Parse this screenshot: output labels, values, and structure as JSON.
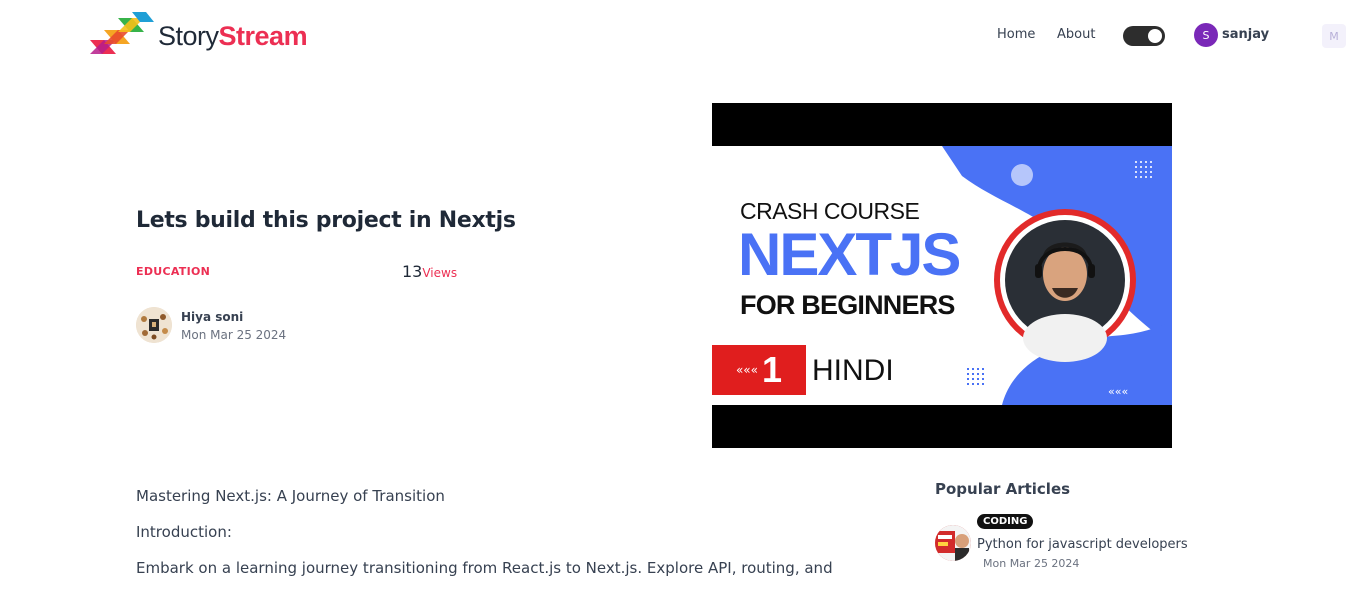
{
  "brand": {
    "part1": "Story",
    "part2": "Stream",
    "accent": "#ec2f53"
  },
  "nav": {
    "home": "Home",
    "about": "About"
  },
  "user": {
    "initial": "S",
    "name": "sanjay"
  },
  "corner_icon": {
    "glyph": "M"
  },
  "article": {
    "title": "Lets build this project in Nextjs",
    "category": "EDUCATION",
    "views_count": "13",
    "views_label": "Views",
    "author": "Hiya soni",
    "date": "Mon Mar 25 2024"
  },
  "hero": {
    "line1": "CRASH COURSE",
    "line2": "NEXTJS",
    "line3": "FOR BEGINNERS",
    "arrows": "«««",
    "number": "1",
    "language": "HINDI"
  },
  "body": {
    "paragraphs": [
      "Mastering Next.js: A Journey of Transition",
      "Introduction:",
      "Embark on a learning journey transitioning from React.js to Next.js. Explore API, routing, and"
    ]
  },
  "popular": {
    "title": "Popular Articles",
    "items": [
      {
        "badge": "CODING",
        "name": "Python for javascript developers",
        "date": "Mon Mar 25 2024"
      }
    ]
  }
}
